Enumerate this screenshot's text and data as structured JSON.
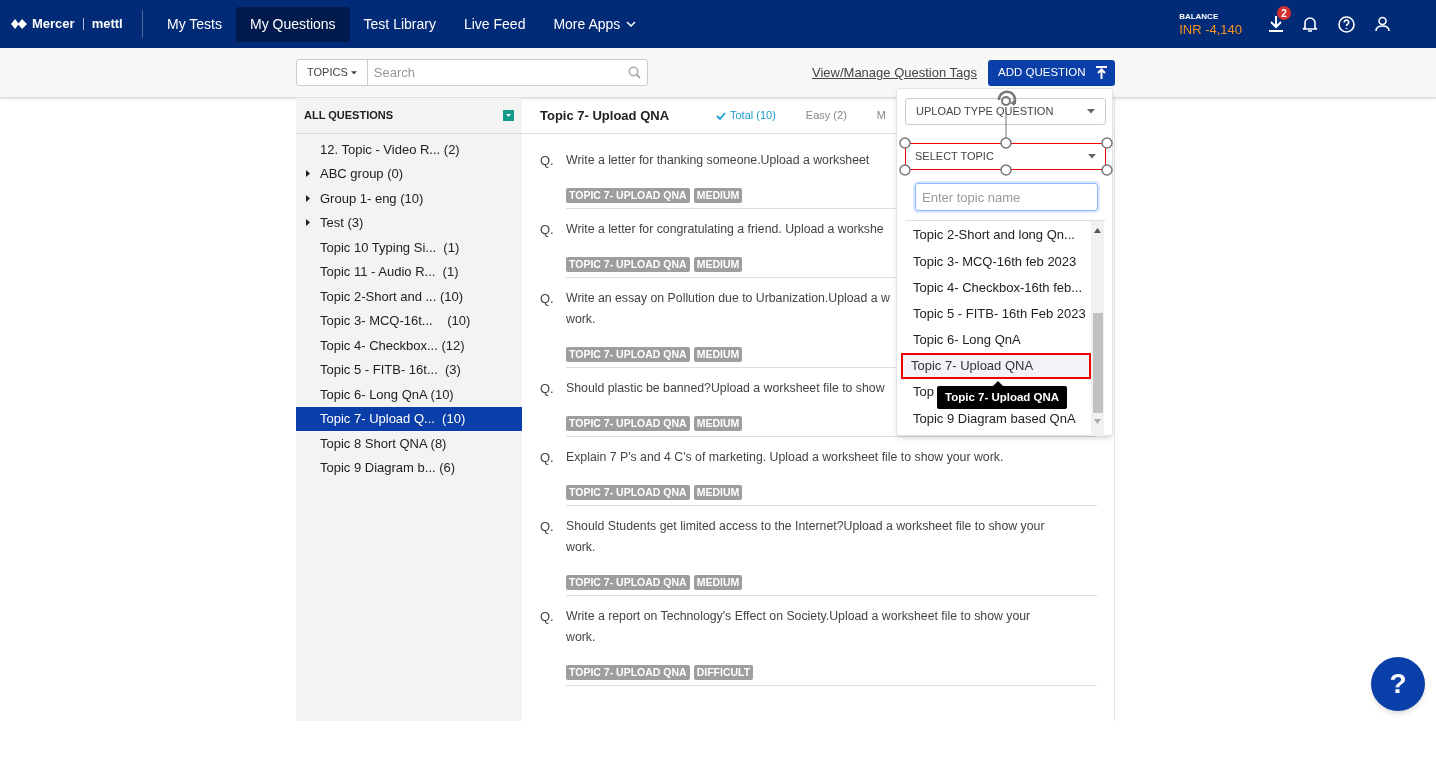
{
  "nav": {
    "logo": {
      "brand": "Mercer",
      "product": "mettl"
    },
    "items": [
      {
        "label": "My Tests",
        "selected": false
      },
      {
        "label": "My Questions",
        "selected": true
      },
      {
        "label": "Test Library",
        "selected": false
      },
      {
        "label": "Live Feed",
        "selected": false
      },
      {
        "label": "More Apps",
        "selected": false,
        "kind": "menu"
      }
    ],
    "balance_label": "BALANCE",
    "balance": "INR -4,140",
    "download_badge": "2"
  },
  "toolbar": {
    "topics_button": "TOPICS",
    "search": {
      "placeholder": "Search"
    },
    "tags_link": "View/Manage Question Tags",
    "add_button": "ADD QUESTION"
  },
  "sidebar": {
    "header": "ALL QUESTIONS",
    "items": [
      {
        "label": "12. Topic - Video R... (2)",
        "kind": "topic",
        "selected": false
      },
      {
        "label": "ABC group (0)",
        "kind": "group",
        "selected": false
      },
      {
        "label": "Group 1- eng (10)",
        "kind": "group",
        "selected": false
      },
      {
        "label": "Test (3)",
        "kind": "group",
        "selected": false
      },
      {
        "label": "Topic 10 Typing Si...  (1)",
        "kind": "topic",
        "selected": false
      },
      {
        "label": "Topic 11 - Audio R...  (1)",
        "kind": "topic",
        "selected": false
      },
      {
        "label": "Topic 2-Short and ... (10)",
        "kind": "topic",
        "selected": false
      },
      {
        "label": "Topic 3- MCQ-16t...    (10)",
        "kind": "topic",
        "selected": false
      },
      {
        "label": "Topic 4- Checkbox... (12)",
        "kind": "topic",
        "selected": false
      },
      {
        "label": "Topic 5 - FITB- 16t...  (3)",
        "kind": "topic",
        "selected": false
      },
      {
        "label": "Topic 6- Long QnA (10)",
        "kind": "topic",
        "selected": false
      },
      {
        "label": "Topic 7- Upload Q...  (10)",
        "kind": "topic",
        "selected": true
      },
      {
        "label": "Topic 8 Short QNA (8)",
        "kind": "topic",
        "selected": false
      },
      {
        "label": "Topic 9 Diagram b... (6)",
        "kind": "topic",
        "selected": false
      }
    ]
  },
  "content": {
    "title": "Topic 7- Upload QNA",
    "filters": [
      {
        "label": "Total (10)",
        "selected": true
      },
      {
        "label": "Easy (2)",
        "selected": false
      },
      {
        "label": "M",
        "selected": false
      }
    ],
    "questions": [
      {
        "marker": "Q.",
        "lines": [
          "Write a letter for thanking someone.Upload a worksheet"
        ],
        "tags": [
          "TOPIC 7- UPLOAD QNA",
          "MEDIUM"
        ]
      },
      {
        "marker": "Q.",
        "lines": [
          "Write a letter for congratulating a friend. Upload a workshe"
        ],
        "tags": [
          "TOPIC 7- UPLOAD QNA",
          "MEDIUM"
        ]
      },
      {
        "marker": "Q.",
        "lines": [
          "Write an essay on Pollution due to Urbanization.Upload a w",
          "work."
        ],
        "tags": [
          "TOPIC 7- UPLOAD QNA",
          "MEDIUM"
        ]
      },
      {
        "marker": "Q.",
        "lines": [
          "Should plastic be banned?Upload a worksheet file to show"
        ],
        "tags": [
          "TOPIC 7- UPLOAD QNA",
          "MEDIUM"
        ]
      },
      {
        "marker": "Q.",
        "lines": [
          "Explain 7 P's and 4 C's of marketing. Upload a worksheet file to show your work."
        ],
        "tags": [
          "TOPIC 7- UPLOAD QNA",
          "MEDIUM"
        ]
      },
      {
        "marker": "Q.",
        "lines": [
          "Should Students get limited access to the Internet?Upload a worksheet file to show your",
          "work."
        ],
        "tags": [
          "TOPIC 7- UPLOAD QNA",
          "MEDIUM"
        ]
      },
      {
        "marker": "Q.",
        "lines": [
          "Write a report on Technology's Effect on Society.Upload a worksheet file to show your",
          "work."
        ],
        "tags": [
          "TOPIC 7- UPLOAD QNA",
          "DIFFICULT"
        ]
      }
    ]
  },
  "popup": {
    "type_select": "UPLOAD TYPE QUESTION",
    "topic_select": "SELECT TOPIC",
    "topic_search": {
      "placeholder": "Enter topic name"
    },
    "options": [
      {
        "label": "Topic 2-Short and long Qn...",
        "selected": false
      },
      {
        "label": "Topic 3- MCQ-16th feb 2023",
        "selected": false
      },
      {
        "label": "Topic 4- Checkbox-16th feb...",
        "selected": false
      },
      {
        "label": "Topic 5 - FITB- 16th Feb 2023",
        "selected": false
      },
      {
        "label": "Topic 6- Long QnA",
        "selected": false
      },
      {
        "label": "Topic 7- Upload QNA",
        "selected": true
      },
      {
        "label": "Top",
        "selected": false
      },
      {
        "label": "Topic 9 Diagram based QnA",
        "selected": false
      }
    ],
    "tooltip": "Topic 7- Upload QNA"
  },
  "help_button": "?"
}
